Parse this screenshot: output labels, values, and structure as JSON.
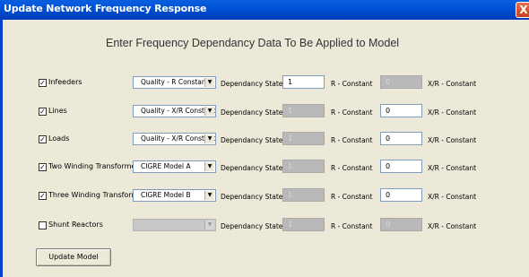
{
  "window": {
    "title": "Update Network Frequency Response",
    "close_label": "X"
  },
  "heading": "Enter Frequency Dependancy Data To Be Applied to Model",
  "rows": [
    {
      "checked": true,
      "label": "Infeeders",
      "model": "Quality - R Constant",
      "model_disabled": false,
      "dep_label": "Dependancy State",
      "r_value": "1",
      "r_disabled": false,
      "r_label": "R - Constant",
      "xr_value": "0",
      "xr_disabled": true,
      "xr_label": "X/R - Constant"
    },
    {
      "checked": true,
      "label": "Lines",
      "model": "Quality - X/R Constant",
      "model_disabled": false,
      "dep_label": "Dependancy State",
      "r_value": "1",
      "r_disabled": true,
      "r_label": "R - Constant",
      "xr_value": "0",
      "xr_disabled": false,
      "xr_label": "X/R - Constant"
    },
    {
      "checked": true,
      "label": "Loads",
      "model": "Quality - X/R Constant (P",
      "model_disabled": false,
      "dep_label": "Dependancy State",
      "r_value": "1",
      "r_disabled": true,
      "r_label": "R - Constant",
      "xr_value": "0",
      "xr_disabled": false,
      "xr_label": "X/R - Constant"
    },
    {
      "checked": true,
      "label": "Two Winding Transformers",
      "model": "CIGRE Model A",
      "model_disabled": false,
      "dep_label": "Dependancy State",
      "r_value": "1",
      "r_disabled": true,
      "r_label": "R - Constant",
      "xr_value": "0",
      "xr_disabled": false,
      "xr_label": "X/R - Constant"
    },
    {
      "checked": true,
      "label": "Three Winding Transformers",
      "model": "CIGRE Model B",
      "model_disabled": false,
      "dep_label": "Dependancy State",
      "r_value": "1",
      "r_disabled": true,
      "r_label": "R - Constant",
      "xr_value": "0",
      "xr_disabled": false,
      "xr_label": "X/R - Constant"
    },
    {
      "checked": false,
      "label": "Shunt Reactors",
      "model": "",
      "model_disabled": true,
      "dep_label": "Dependancy State",
      "r_value": "1",
      "r_disabled": true,
      "r_label": "R - Constant",
      "xr_value": "0",
      "xr_disabled": true,
      "xr_label": "X/R - Constant"
    }
  ],
  "checkbox_mark": "✓",
  "update_button": "Update Model",
  "colors": {
    "titlebar": "#0052d6",
    "dialog": "#ece9d8",
    "disabled_field": "#b9b9b9"
  }
}
